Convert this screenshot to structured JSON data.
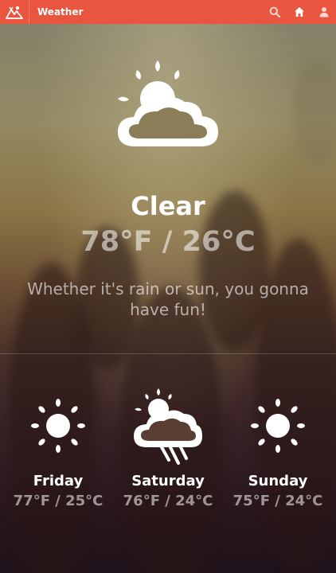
{
  "header": {
    "title": "Weather",
    "bar_color": "#e9553e",
    "logo_icon": "mountains-icon",
    "actions": [
      {
        "icon": "search-icon"
      },
      {
        "icon": "home-icon"
      },
      {
        "icon": "user-icon"
      }
    ]
  },
  "current": {
    "icon": "sun-cloud-icon",
    "condition": "Clear",
    "temperature": "78°F / 26°C",
    "tagline": "Whether it's rain or sun, you gonna have fun!"
  },
  "forecast": [
    {
      "day": "Friday",
      "temperature": "77°F / 25°C",
      "icon": "sun-icon"
    },
    {
      "day": "Saturday",
      "temperature": "76°F / 24°C",
      "icon": "sun-cloud-rain-icon"
    },
    {
      "day": "Sunday",
      "temperature": "75°F / 24°C",
      "icon": "sun-icon"
    }
  ]
}
